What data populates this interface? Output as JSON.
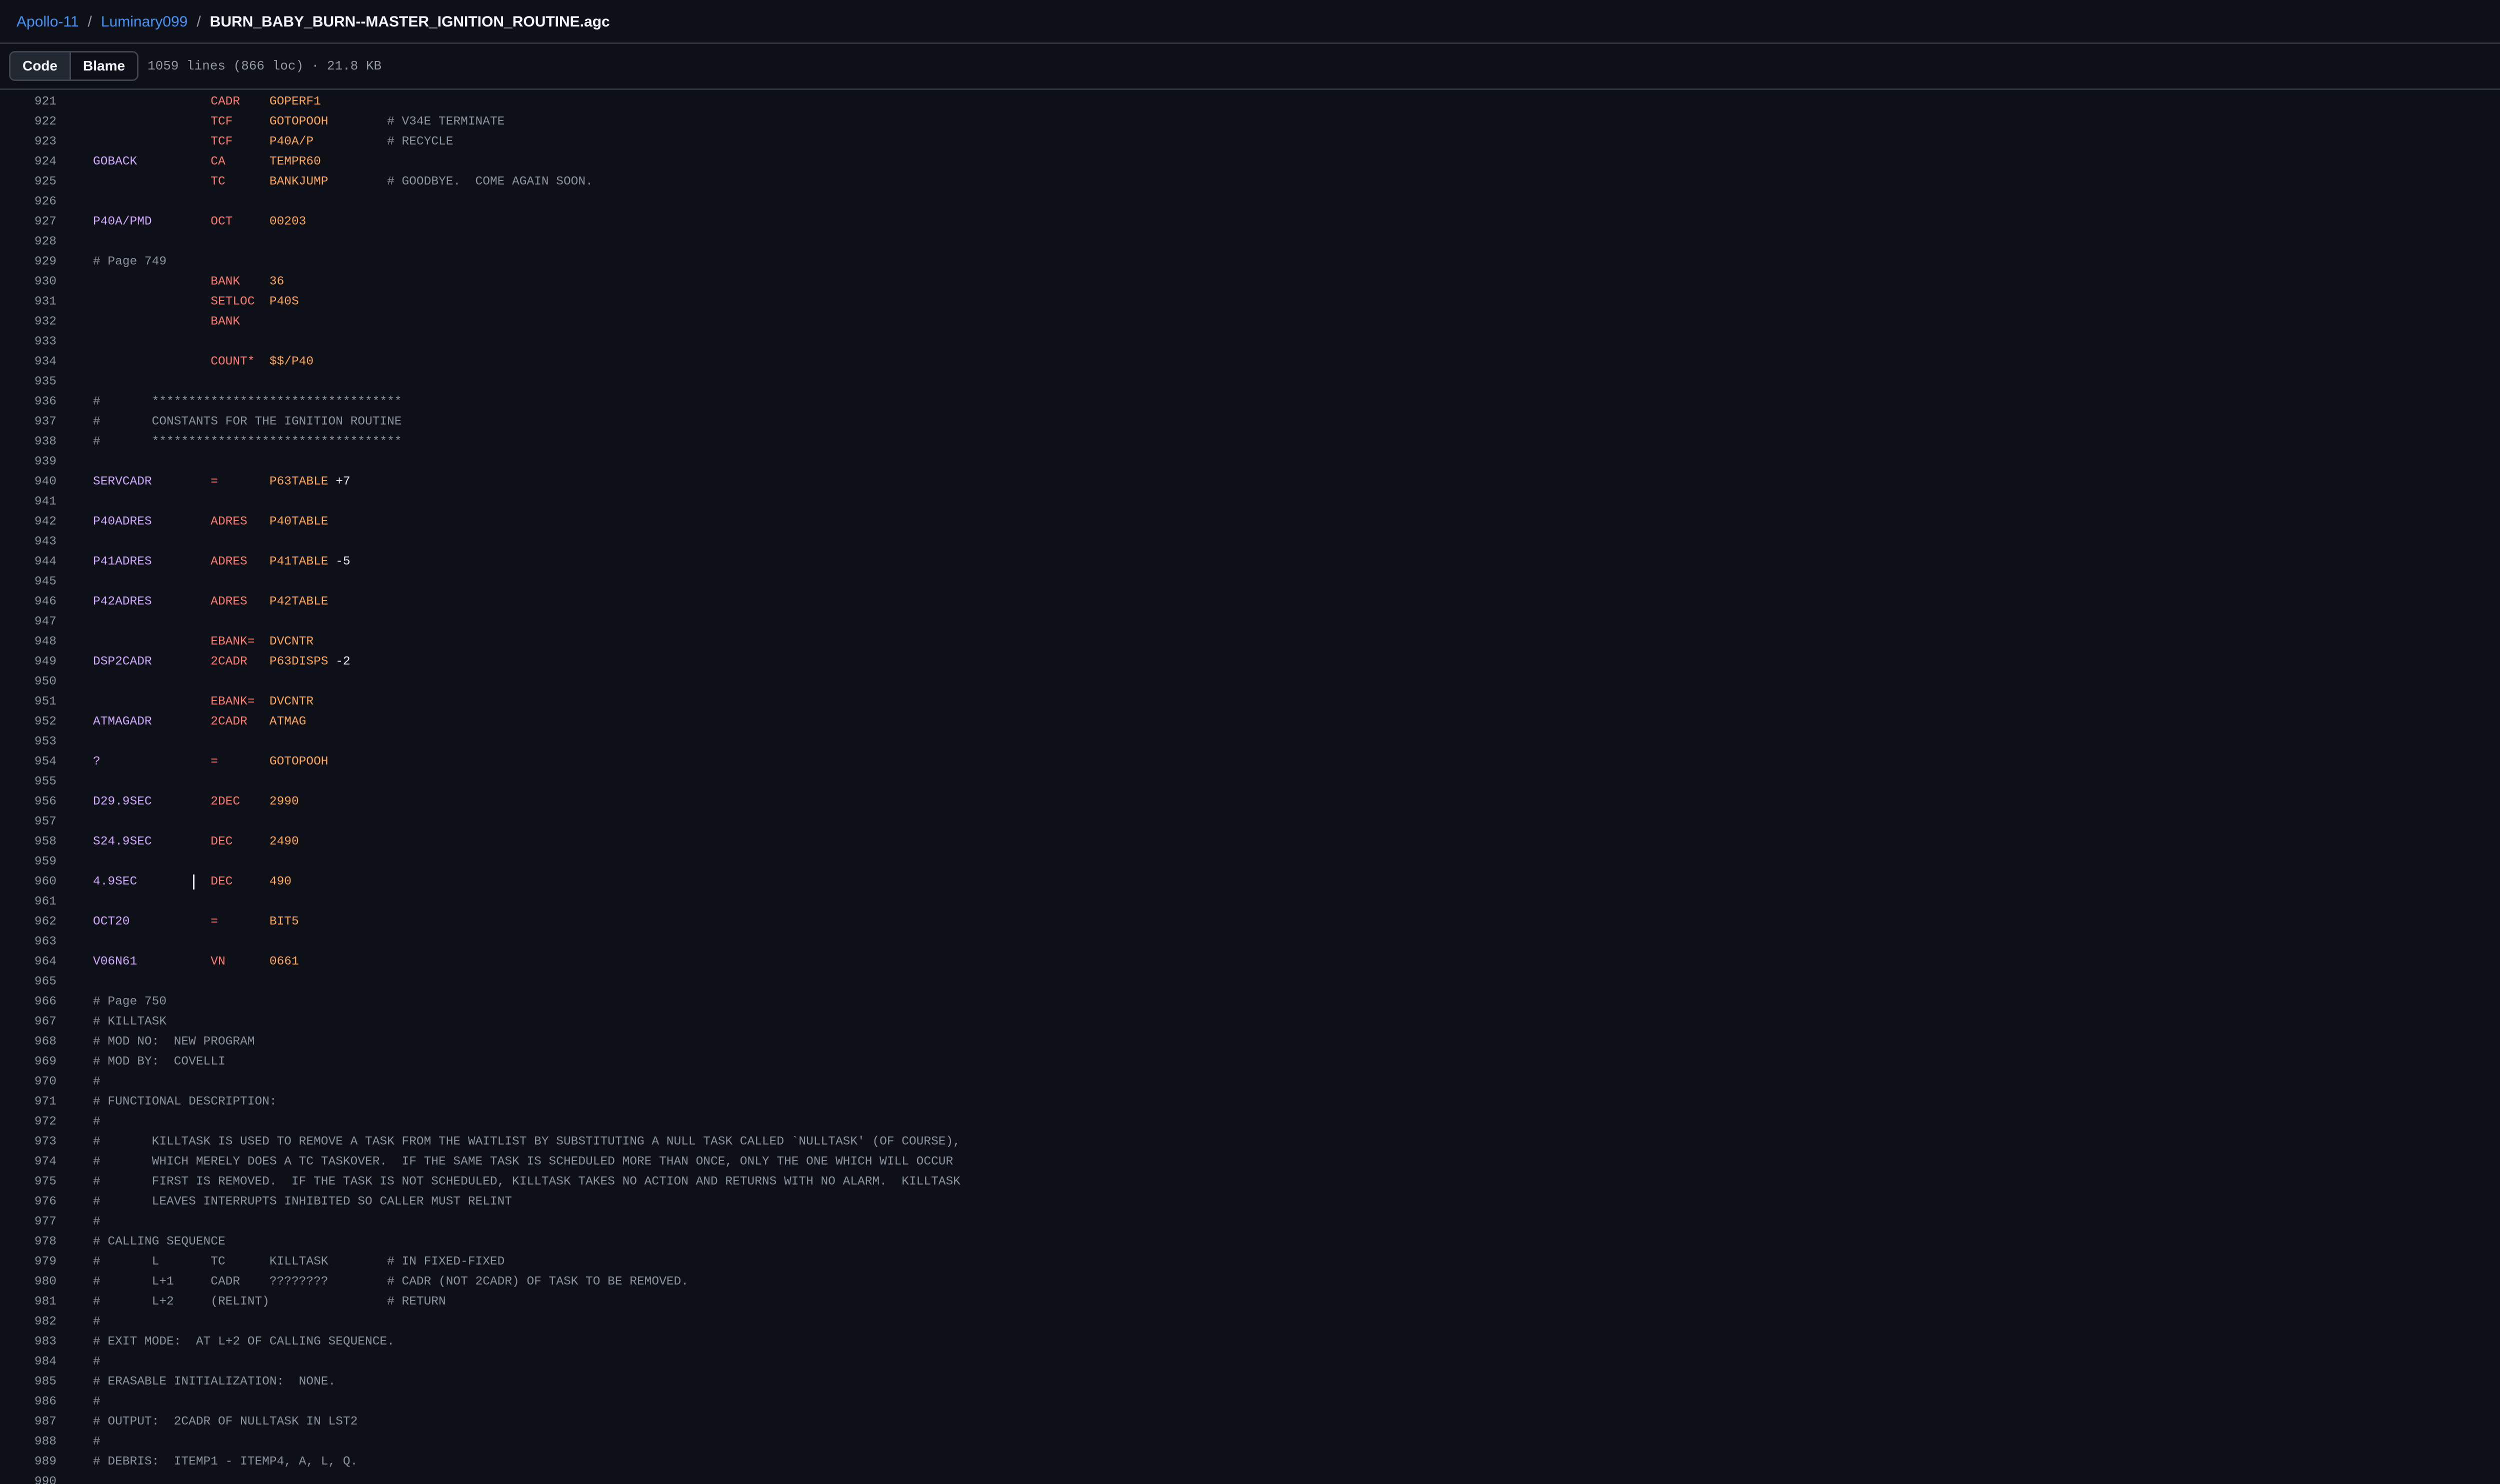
{
  "breadcrumb": {
    "repo": "Apollo-11",
    "folder": "Luminary099",
    "file": "BURN_BABY_BURN--MASTER_IGNITION_ROUTINE.agc"
  },
  "toolbar": {
    "code_label": "Code",
    "blame_label": "Blame",
    "file_stats": "1059 lines (866 loc) · 21.8 KB",
    "folder_icon": "folder-open-icon",
    "copilot_icon": "copilot-icon"
  },
  "colors": {
    "label": "#d2a8ff",
    "opcode": "#ff7b72",
    "operand": "#ffa657",
    "comment": "#8b949e",
    "link": "#4493f8",
    "background": "#0d1117"
  },
  "cursor_line": 960,
  "code_lines": [
    {
      "n": "921",
      "op": "CADR",
      "arg": "GOPERF1"
    },
    {
      "n": "922",
      "op": "TCF",
      "arg": "GOTOPOOH",
      "comment": "# V34E TERMINATE"
    },
    {
      "n": "923",
      "op": "TCF",
      "arg": "P40A/P",
      "comment": "# RECYCLE"
    },
    {
      "n": "924",
      "label": "GOBACK",
      "op": "CA",
      "arg": "TEMPR60"
    },
    {
      "n": "925",
      "op": "TC",
      "arg": "BANKJUMP",
      "comment": "# GOODBYE.  COME AGAIN SOON."
    },
    {
      "n": "926"
    },
    {
      "n": "927",
      "label": "P40A/PMD",
      "op": "OCT",
      "arg": "00203"
    },
    {
      "n": "928"
    },
    {
      "n": "929",
      "full_comment": "# Page 749"
    },
    {
      "n": "930",
      "op": "BANK",
      "arg": "36"
    },
    {
      "n": "931",
      "op": "SETLOC",
      "arg": "P40S"
    },
    {
      "n": "932",
      "op": "BANK"
    },
    {
      "n": "933"
    },
    {
      "n": "934",
      "op": "COUNT*",
      "arg": "$$/P40"
    },
    {
      "n": "935"
    },
    {
      "n": "936",
      "full_comment": "#       **********************************"
    },
    {
      "n": "937",
      "full_comment": "#       CONSTANTS FOR THE IGNITION ROUTINE"
    },
    {
      "n": "938",
      "full_comment": "#       **********************************"
    },
    {
      "n": "939"
    },
    {
      "n": "940",
      "label": "SERVCADR",
      "op": "=",
      "arg": "P63TABLE",
      "suffix": " +7"
    },
    {
      "n": "941"
    },
    {
      "n": "942",
      "label": "P40ADRES",
      "op": "ADRES",
      "arg": "P40TABLE"
    },
    {
      "n": "943"
    },
    {
      "n": "944",
      "label": "P41ADRES",
      "op": "ADRES",
      "arg": "P41TABLE",
      "suffix": " -5"
    },
    {
      "n": "945"
    },
    {
      "n": "946",
      "label": "P42ADRES",
      "op": "ADRES",
      "arg": "P42TABLE"
    },
    {
      "n": "947"
    },
    {
      "n": "948",
      "op": "EBANK=",
      "arg": "DVCNTR"
    },
    {
      "n": "949",
      "label": "DSP2CADR",
      "op": "2CADR",
      "arg": "P63DISPS",
      "suffix": " -2"
    },
    {
      "n": "950"
    },
    {
      "n": "951",
      "op": "EBANK=",
      "arg": "DVCNTR"
    },
    {
      "n": "952",
      "label": "ATMAGADR",
      "op": "2CADR",
      "arg": "ATMAG"
    },
    {
      "n": "953"
    },
    {
      "n": "954",
      "label": "?",
      "op": "=",
      "arg": "GOTOPOOH"
    },
    {
      "n": "955"
    },
    {
      "n": "956",
      "label": "D29.9SEC",
      "op": "2DEC",
      "arg": "2990"
    },
    {
      "n": "957"
    },
    {
      "n": "958",
      "label": "S24.9SEC",
      "op": "DEC",
      "arg": "2490"
    },
    {
      "n": "959"
    },
    {
      "n": "960",
      "label": "4.9SEC",
      "op": "DEC",
      "arg": "490"
    },
    {
      "n": "961"
    },
    {
      "n": "962",
      "label": "OCT20",
      "op": "=",
      "arg": "BIT5"
    },
    {
      "n": "963"
    },
    {
      "n": "964",
      "label": "V06N61",
      "op": "VN",
      "arg": "0661"
    },
    {
      "n": "965"
    },
    {
      "n": "966",
      "full_comment": "# Page 750"
    },
    {
      "n": "967",
      "full_comment": "# KILLTASK"
    },
    {
      "n": "968",
      "full_comment": "# MOD NO:  NEW PROGRAM"
    },
    {
      "n": "969",
      "full_comment": "# MOD BY:  COVELLI"
    },
    {
      "n": "970",
      "full_comment": "#"
    },
    {
      "n": "971",
      "full_comment": "# FUNCTIONAL DESCRIPTION:"
    },
    {
      "n": "972",
      "full_comment": "#"
    },
    {
      "n": "973",
      "full_comment": "#       KILLTASK IS USED TO REMOVE A TASK FROM THE WAITLIST BY SUBSTITUTING A NULL TASK CALLED `NULLTASK' (OF COURSE),"
    },
    {
      "n": "974",
      "full_comment": "#       WHICH MERELY DOES A TC TASKOVER.  IF THE SAME TASK IS SCHEDULED MORE THAN ONCE, ONLY THE ONE WHICH WILL OCCUR"
    },
    {
      "n": "975",
      "full_comment": "#       FIRST IS REMOVED.  IF THE TASK IS NOT SCHEDULED, KILLTASK TAKES NO ACTION AND RETURNS WITH NO ALARM.  KILLTASK"
    },
    {
      "n": "976",
      "full_comment": "#       LEAVES INTERRUPTS INHIBITED SO CALLER MUST RELINT"
    },
    {
      "n": "977",
      "full_comment": "#"
    },
    {
      "n": "978",
      "full_comment": "# CALLING SEQUENCE"
    },
    {
      "n": "979",
      "full_comment": "#       L       TC      KILLTASK        # IN FIXED-FIXED"
    },
    {
      "n": "980",
      "full_comment": "#       L+1     CADR    ????????        # CADR (NOT 2CADR) OF TASK TO BE REMOVED."
    },
    {
      "n": "981",
      "full_comment": "#       L+2     (RELINT)                # RETURN"
    },
    {
      "n": "982",
      "full_comment": "#"
    },
    {
      "n": "983",
      "full_comment": "# EXIT MODE:  AT L+2 OF CALLING SEQUENCE."
    },
    {
      "n": "984",
      "full_comment": "#"
    },
    {
      "n": "985",
      "full_comment": "# ERASABLE INITIALIZATION:  NONE."
    },
    {
      "n": "986",
      "full_comment": "#"
    },
    {
      "n": "987",
      "full_comment": "# OUTPUT:  2CADR OF NULLTASK IN LST2"
    },
    {
      "n": "988",
      "full_comment": "#"
    },
    {
      "n": "989",
      "full_comment": "# DEBRIS:  ITEMP1 - ITEMP4, A, L, Q."
    },
    {
      "n": "990"
    }
  ]
}
